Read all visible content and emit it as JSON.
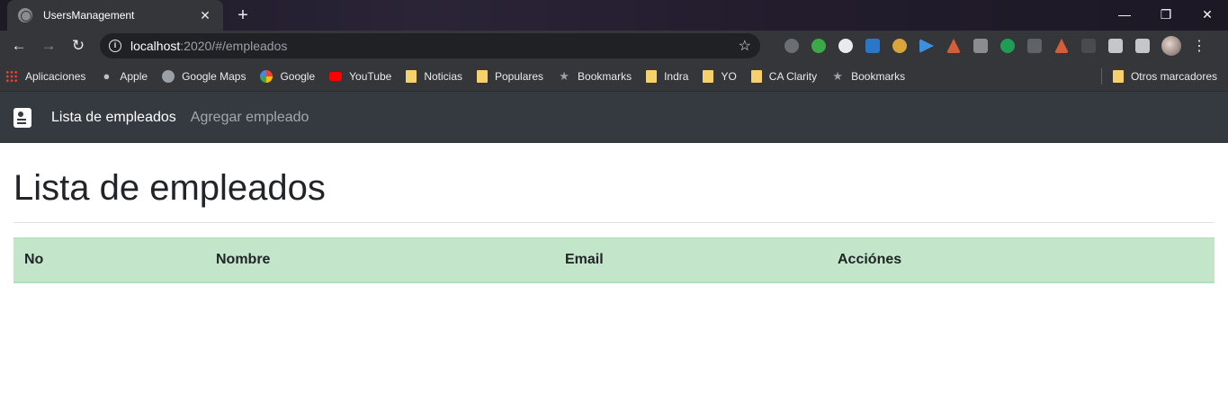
{
  "browser": {
    "tab_title": "UsersManagement",
    "tab_close": "✕",
    "new_tab": "+",
    "window_controls": {
      "minimize": "—",
      "restore": "❐",
      "close": "✕"
    },
    "nav": {
      "back": "←",
      "forward": "→",
      "reload": "↻"
    },
    "url_host": "localhost",
    "url_rest": ":2020/#/empleados",
    "bookmark_star": "☆",
    "menu": "⋮",
    "extension_icons": [
      "lastpass-icon",
      "pushbullet-icon",
      "ext-icon",
      "uipath-icon",
      "ext-search-icon",
      "ext-play-icon",
      "adobe-icon",
      "ext-gray-icon",
      "ext-green-icon",
      "ext-grid-icon",
      "acrobat-icon",
      "ext-brackets-icon",
      "puzzle-icon",
      "media-icon"
    ],
    "bookmarks": [
      {
        "label": "Aplicaciones",
        "icon": "apps-icon"
      },
      {
        "label": "Apple",
        "icon": "apple-icon"
      },
      {
        "label": "Google Maps",
        "icon": "globe-icon"
      },
      {
        "label": "Google",
        "icon": "google-icon"
      },
      {
        "label": "YouTube",
        "icon": "youtube-icon"
      },
      {
        "label": "Noticias",
        "icon": "folder-icon"
      },
      {
        "label": "Populares",
        "icon": "folder-icon"
      },
      {
        "label": "Bookmarks",
        "icon": "star-icon"
      },
      {
        "label": "Indra",
        "icon": "folder-icon"
      },
      {
        "label": "YO",
        "icon": "folder-icon"
      },
      {
        "label": "CA Clarity",
        "icon": "folder-icon"
      },
      {
        "label": "Bookmarks",
        "icon": "star-icon"
      }
    ],
    "other_bookmarks": "Otros marcadores"
  },
  "app": {
    "nav": {
      "active_link": "Lista de empleados",
      "link_add": "Agregar empleado"
    },
    "page_title": "Lista de empleados",
    "table": {
      "headers": [
        "No",
        "Nombre",
        "Email",
        "Acciónes"
      ],
      "rows": []
    }
  },
  "colors": {
    "navbar": "#343a40",
    "table_header": "#c3e6cb",
    "text": "#212529"
  }
}
